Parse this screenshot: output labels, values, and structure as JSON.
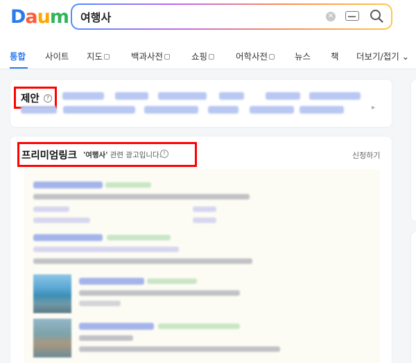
{
  "header": {
    "logo": [
      "D",
      "a",
      "u",
      "m"
    ],
    "search": {
      "value": "여행사",
      "placeholder": ""
    }
  },
  "tabs": [
    {
      "label": "통합",
      "active": true,
      "square": false
    },
    {
      "label": "사이트",
      "active": false,
      "square": false
    },
    {
      "label": "지도",
      "active": false,
      "square": true
    },
    {
      "label": "백과사전",
      "active": false,
      "square": true
    },
    {
      "label": "쇼핑",
      "active": false,
      "square": true
    },
    {
      "label": "어학사전",
      "active": false,
      "square": true
    },
    {
      "label": "뉴스",
      "active": false,
      "square": false
    },
    {
      "label": "책",
      "active": false,
      "square": false
    },
    {
      "label": "더보기/접기 ⌄",
      "active": false,
      "square": false
    }
  ],
  "suggest": {
    "title": "제안",
    "help": "?"
  },
  "premium": {
    "title": "프리미엄링크",
    "query": "'여행사'",
    "note": " 관련 광고입니다.",
    "info": "!",
    "apply": "신청하기"
  },
  "colors": {
    "accent": "#2a7bef",
    "highlight": "#ff0000"
  },
  "icons": {
    "clear": "clear-icon",
    "keyboard": "keyboard-icon",
    "search": "search-icon",
    "help": "help-icon",
    "info": "info-icon"
  }
}
